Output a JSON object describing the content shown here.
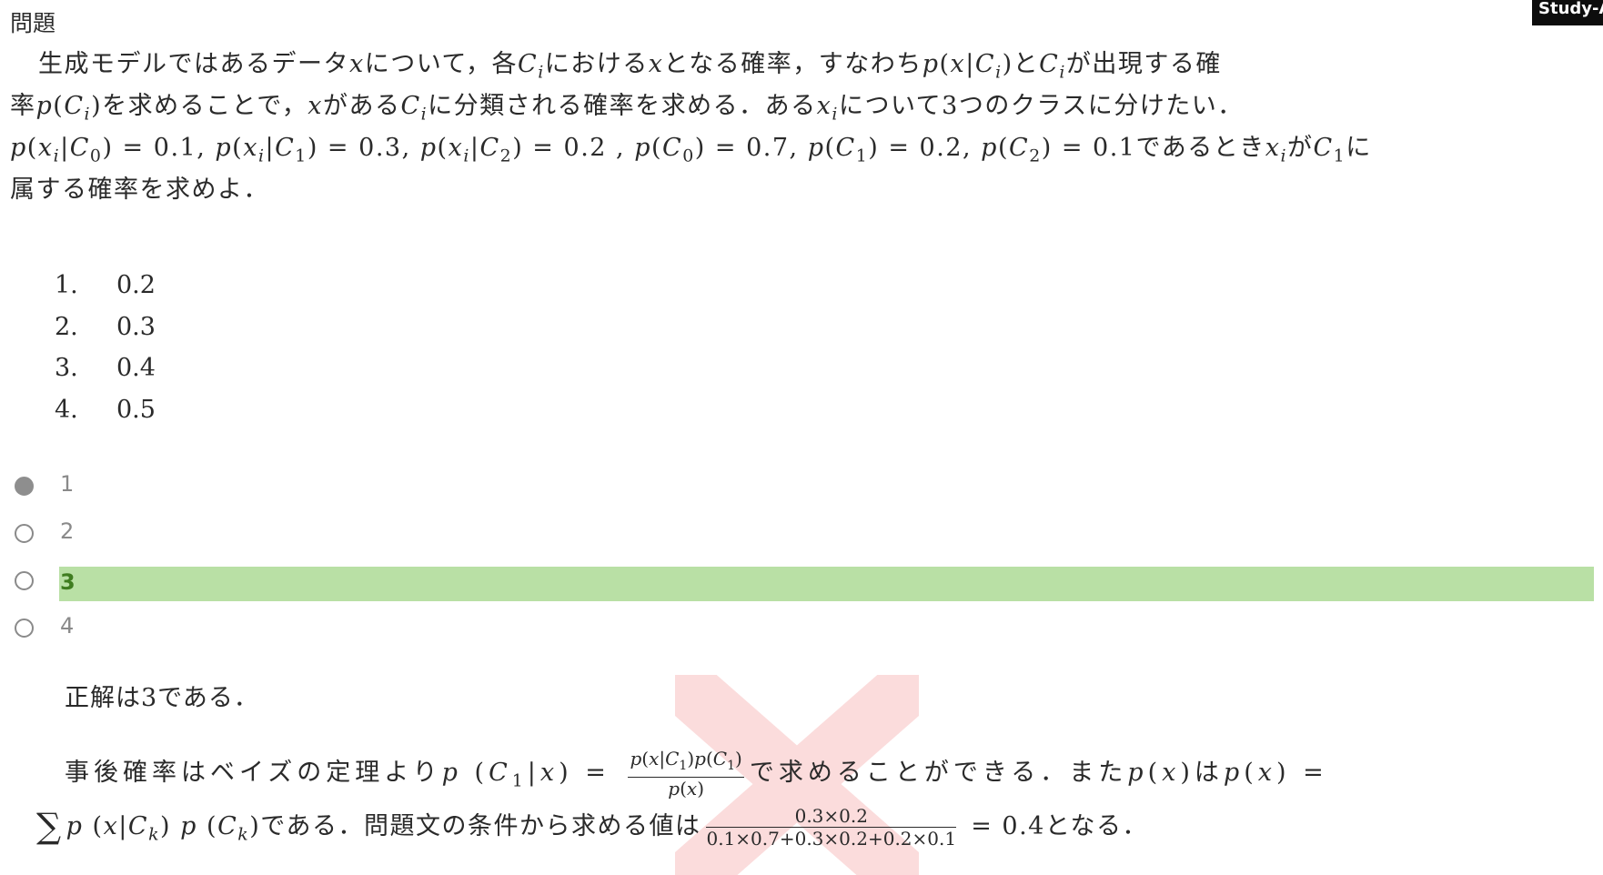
{
  "heading": "問題",
  "badge": "Study-AI",
  "question": {
    "line1": [
      {
        "t": "生成モデルではあるデータ"
      },
      {
        "t": "x",
        "i": true
      },
      {
        "t": "について，各"
      },
      {
        "t": "C",
        "i": true
      },
      {
        "t": "i",
        "i": true,
        "sub": true
      },
      {
        "t": "における"
      },
      {
        "t": "x",
        "i": true
      },
      {
        "t": "となる確率，すなわち"
      },
      {
        "t": "p",
        "i": true
      },
      {
        "t": "("
      },
      {
        "t": "x",
        "i": true
      },
      {
        "t": "|"
      },
      {
        "t": "C",
        "i": true
      },
      {
        "t": "i",
        "i": true,
        "sub": true
      },
      {
        "t": ")と"
      },
      {
        "t": "C",
        "i": true
      },
      {
        "t": "i",
        "i": true,
        "sub": true
      },
      {
        "t": "が出現する確"
      }
    ],
    "line2": [
      {
        "t": "率"
      },
      {
        "t": "p",
        "i": true
      },
      {
        "t": "("
      },
      {
        "t": "C",
        "i": true
      },
      {
        "t": "i",
        "i": true,
        "sub": true
      },
      {
        "t": ")を求めることで，"
      },
      {
        "t": "x",
        "i": true
      },
      {
        "t": "がある"
      },
      {
        "t": "C",
        "i": true
      },
      {
        "t": "i",
        "i": true,
        "sub": true
      },
      {
        "t": "に分類される確率を求める．ある"
      },
      {
        "t": "x",
        "i": true
      },
      {
        "t": "i",
        "i": true,
        "sub": true
      },
      {
        "t": "について3つのクラスに分けたい．"
      }
    ],
    "line3": [
      {
        "t": "p",
        "i": true
      },
      {
        "t": "("
      },
      {
        "t": "x",
        "i": true
      },
      {
        "t": "i",
        "i": true,
        "sub": true
      },
      {
        "t": "|"
      },
      {
        "t": "C",
        "i": true
      },
      {
        "t": "0",
        "sub": true
      },
      {
        "t": ") = 0.1, "
      },
      {
        "t": "p",
        "i": true
      },
      {
        "t": "("
      },
      {
        "t": "x",
        "i": true
      },
      {
        "t": "i",
        "i": true,
        "sub": true
      },
      {
        "t": "|"
      },
      {
        "t": "C",
        "i": true
      },
      {
        "t": "1",
        "sub": true
      },
      {
        "t": ") = 0.3, "
      },
      {
        "t": "p",
        "i": true
      },
      {
        "t": "("
      },
      {
        "t": "x",
        "i": true
      },
      {
        "t": "i",
        "i": true,
        "sub": true
      },
      {
        "t": "|"
      },
      {
        "t": "C",
        "i": true
      },
      {
        "t": "2",
        "sub": true
      },
      {
        "t": ") = 0.2 , "
      },
      {
        "t": "p",
        "i": true
      },
      {
        "t": "("
      },
      {
        "t": "C",
        "i": true
      },
      {
        "t": "0",
        "sub": true
      },
      {
        "t": ") = 0.7, "
      },
      {
        "t": "p",
        "i": true
      },
      {
        "t": "("
      },
      {
        "t": "C",
        "i": true
      },
      {
        "t": "1",
        "sub": true
      },
      {
        "t": ") = 0.2, "
      },
      {
        "t": "p",
        "i": true
      },
      {
        "t": "("
      },
      {
        "t": "C",
        "i": true
      },
      {
        "t": "2",
        "sub": true
      },
      {
        "t": ") = 0.1であるとき"
      },
      {
        "t": "x",
        "i": true
      },
      {
        "t": "i",
        "i": true,
        "sub": true
      },
      {
        "t": "が"
      },
      {
        "t": "C",
        "i": true
      },
      {
        "t": "1",
        "sub": true
      },
      {
        "t": "に"
      }
    ],
    "line4": [
      {
        "t": "属する確率を求めよ．"
      }
    ]
  },
  "options": [
    {
      "num": "1.",
      "value": "0.2"
    },
    {
      "num": "2.",
      "value": "0.3"
    },
    {
      "num": "3.",
      "value": "0.4"
    },
    {
      "num": "4.",
      "value": "0.5"
    }
  ],
  "choices": [
    {
      "label": "1",
      "selected": true,
      "correct": false
    },
    {
      "label": "2",
      "selected": false,
      "correct": false
    },
    {
      "label": "3",
      "selected": false,
      "correct": true
    },
    {
      "label": "4",
      "selected": false,
      "correct": false
    }
  ],
  "explanation": {
    "answer": "正解は3である．",
    "line1_pre": [
      {
        "t": "事後確率はベイズの定理より"
      },
      {
        "t": "p",
        "i": true
      },
      {
        "t": " ("
      },
      {
        "t": "C",
        "i": true
      },
      {
        "t": "1",
        "sub": true
      },
      {
        "t": "|"
      },
      {
        "t": "x",
        "i": true
      },
      {
        "t": ")  =  "
      }
    ],
    "frac1_num": [
      {
        "t": "p",
        "i": true
      },
      {
        "t": "("
      },
      {
        "t": "x",
        "i": true
      },
      {
        "t": "|"
      },
      {
        "t": "C",
        "i": true
      },
      {
        "t": "1",
        "sub": true
      },
      {
        "t": ")"
      },
      {
        "t": "p",
        "i": true
      },
      {
        "t": "("
      },
      {
        "t": "C",
        "i": true
      },
      {
        "t": "1",
        "sub": true
      },
      {
        "t": ")"
      }
    ],
    "frac1_den": [
      {
        "t": "p",
        "i": true
      },
      {
        "t": "("
      },
      {
        "t": "x",
        "i": true
      },
      {
        "t": ")"
      }
    ],
    "line1_post": [
      {
        "t": "で求めることができる．また"
      },
      {
        "t": "p",
        "i": true
      },
      {
        "t": "("
      },
      {
        "t": "x",
        "i": true
      },
      {
        "t": ")は"
      },
      {
        "t": "p",
        "i": true
      },
      {
        "t": "("
      },
      {
        "t": "x",
        "i": true
      },
      {
        "t": ")  ="
      }
    ],
    "sum_symbol": "∑",
    "line2_pre": [
      {
        "t": "p",
        "i": true
      },
      {
        "t": " ("
      },
      {
        "t": "x",
        "i": true
      },
      {
        "t": "|"
      },
      {
        "t": "C",
        "i": true
      },
      {
        "t": "k",
        "i": true,
        "sub": true
      },
      {
        "t": ") "
      },
      {
        "t": "p",
        "i": true
      },
      {
        "t": " ("
      },
      {
        "t": "C",
        "i": true
      },
      {
        "t": "k",
        "i": true,
        "sub": true
      },
      {
        "t": ")である．問題文の条件から求める値は"
      }
    ],
    "frac2_num": "0.3×0.2",
    "frac2_den": "0.1×0.7+0.3×0.2+0.2×0.1",
    "line2_post": " = 0.4となる．"
  },
  "colors": {
    "highlight": "#b9e0a5",
    "correct_text": "#3f7d20",
    "wrong_mark": "#fbdcdc",
    "radio_selected": "#8e8e8e"
  },
  "icons": {
    "wrong_mark": "cross-mark-icon"
  }
}
